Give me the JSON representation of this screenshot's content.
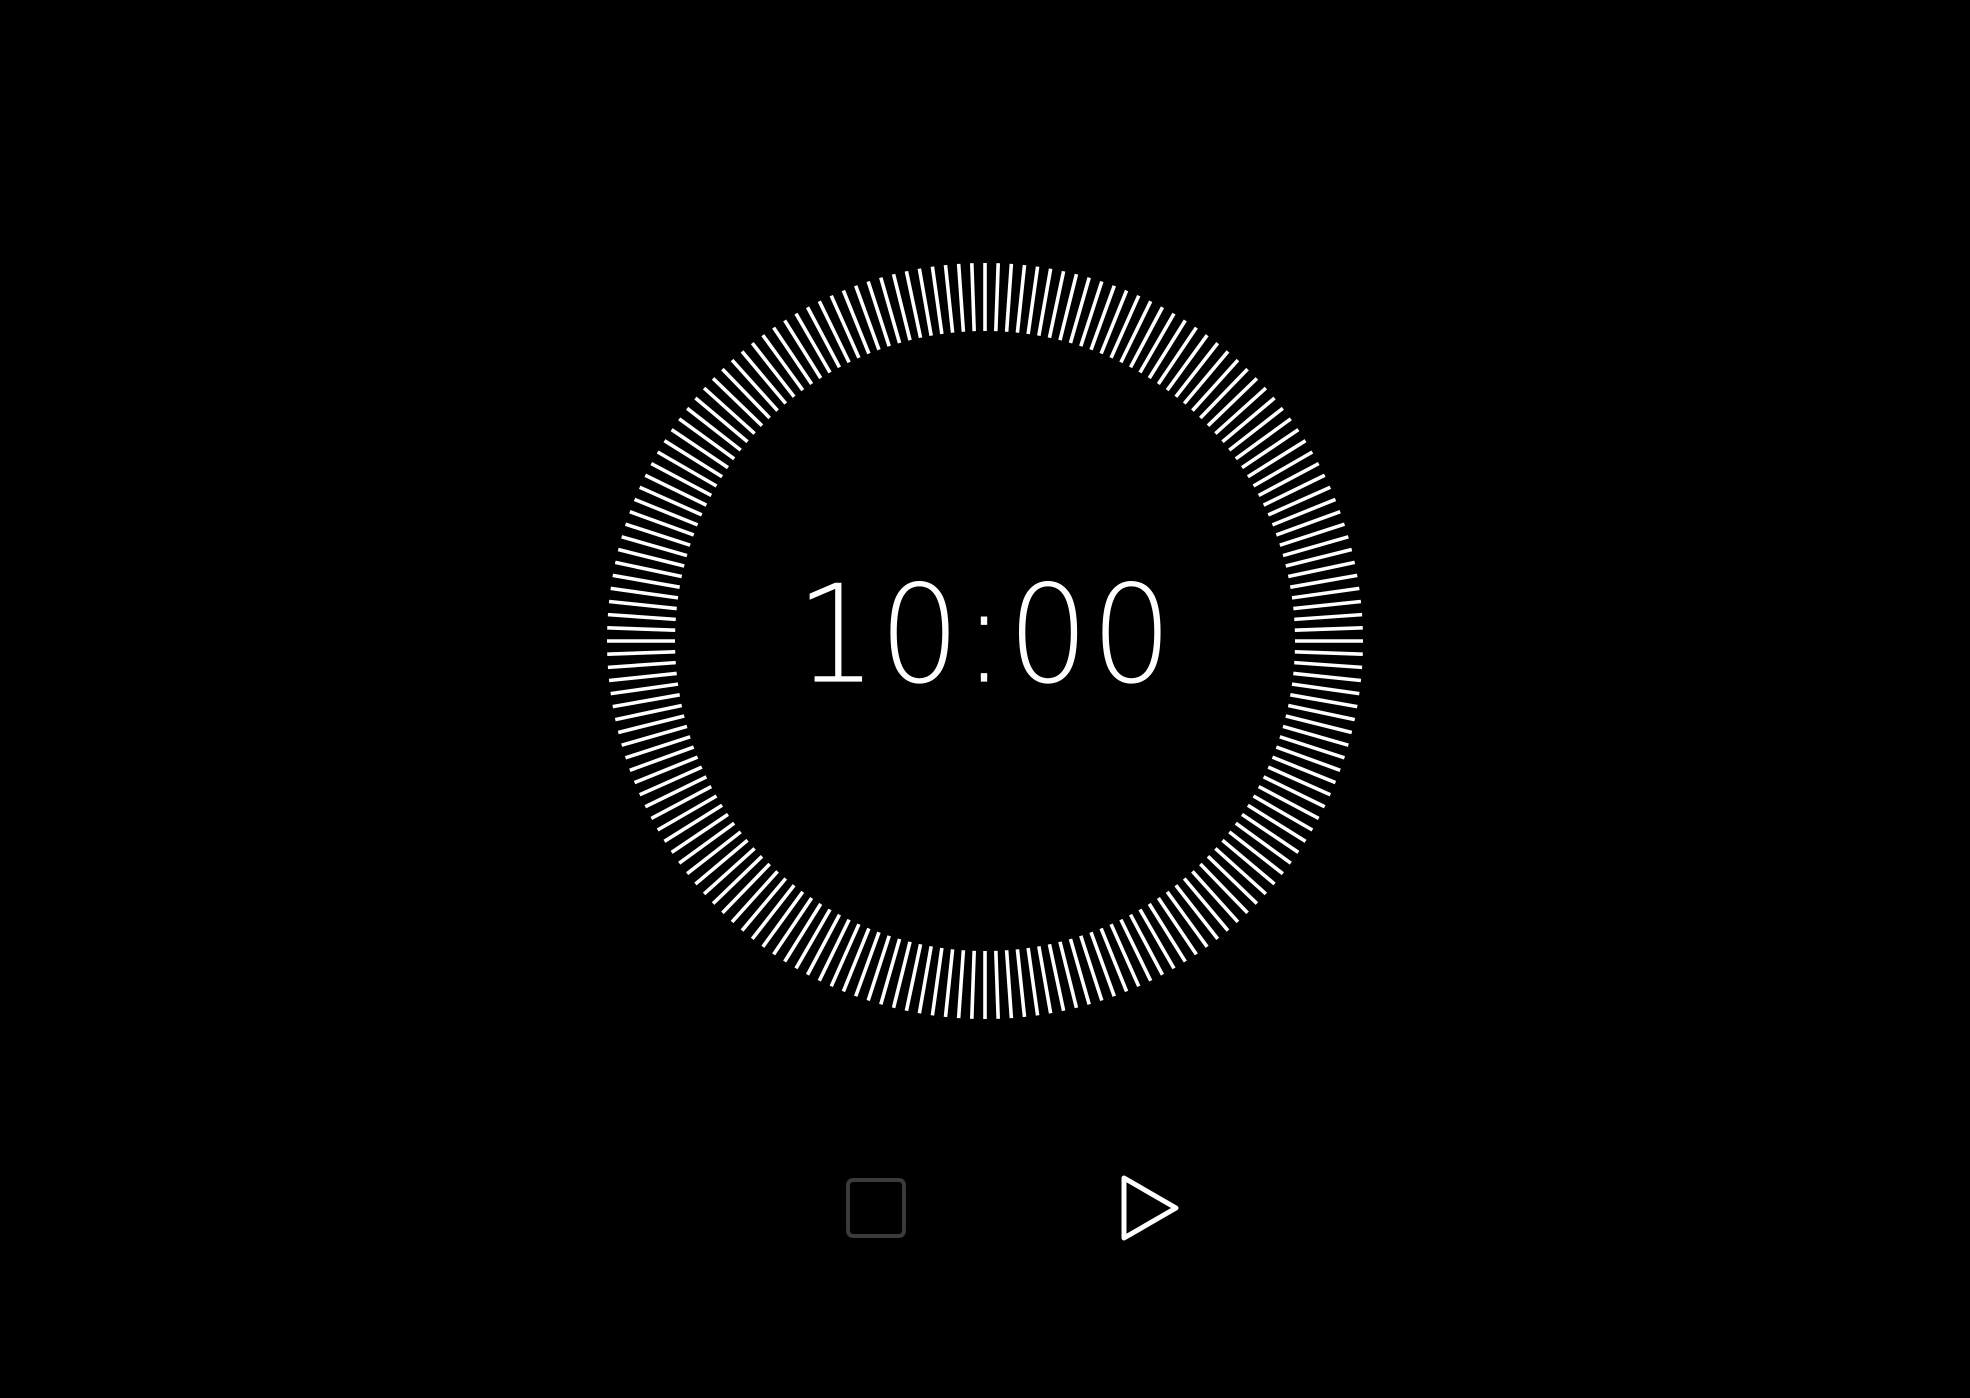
{
  "timer": {
    "display": "10:00"
  },
  "dial": {
    "tick_count": 180,
    "tick_color": "#ffffff",
    "progress": 1.0
  },
  "controls": {
    "stop": {
      "icon": "stop-square-icon",
      "state": "disabled",
      "color": "#3a3a3a"
    },
    "play": {
      "icon": "play-triangle-icon",
      "state": "enabled",
      "color": "#ffffff"
    }
  },
  "theme": {
    "background": "#000000",
    "foreground": "#ffffff"
  }
}
